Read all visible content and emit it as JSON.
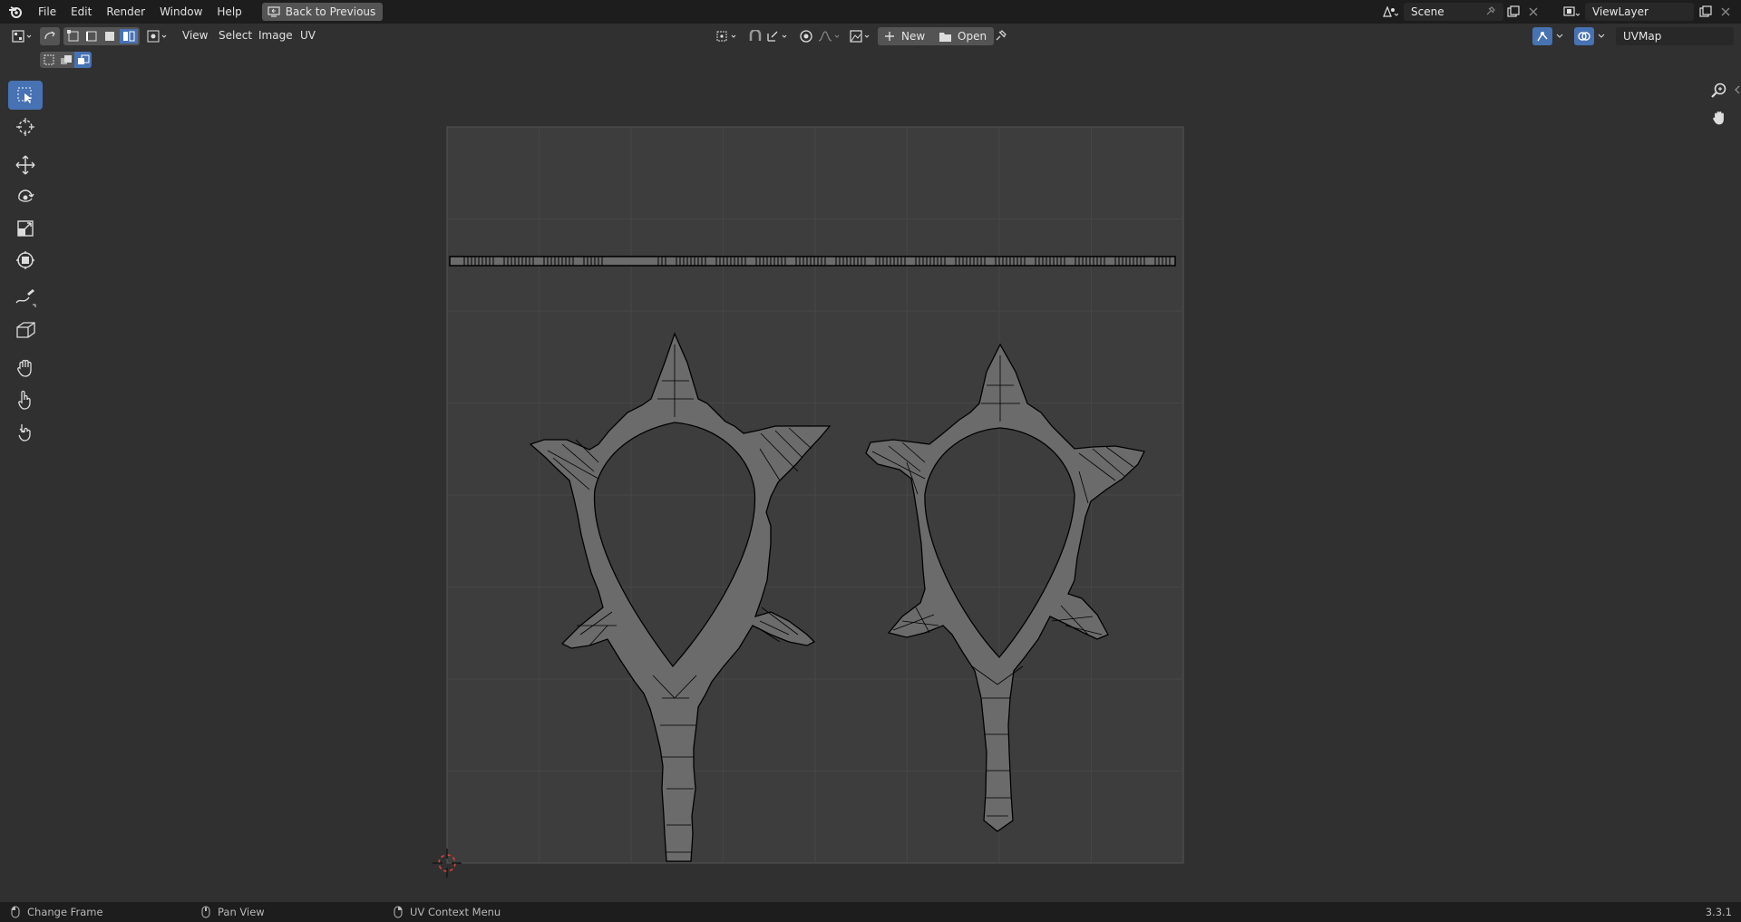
{
  "topbar": {
    "menus": [
      "File",
      "Edit",
      "Render",
      "Window",
      "Help"
    ],
    "back_button": "Back to Previous",
    "scene": "Scene",
    "view_layer": "ViewLayer"
  },
  "header": {
    "menus": [
      "View",
      "Select",
      "Image",
      "UV"
    ],
    "new_label": "New",
    "open_label": "Open",
    "uv_map": "UVMap"
  },
  "toolbar": {
    "tools": [
      "select-box-tool",
      "cursor-tool",
      "move-tool",
      "rotate-tool",
      "scale-tool",
      "transform-tool",
      "annotate-tool",
      "rip-region-tool",
      "grab-tool",
      "relax-tool",
      "pinch-tool"
    ],
    "active": "select-box-tool"
  },
  "statusbar": {
    "items": [
      "Change Frame",
      "Pan View",
      "UV Context Menu"
    ],
    "version": "3.3.1"
  },
  "colors": {
    "accent": "#4772b3",
    "background": "#303030",
    "topbar": "#1d1d1d",
    "uv_face": "#6b6b6b"
  }
}
